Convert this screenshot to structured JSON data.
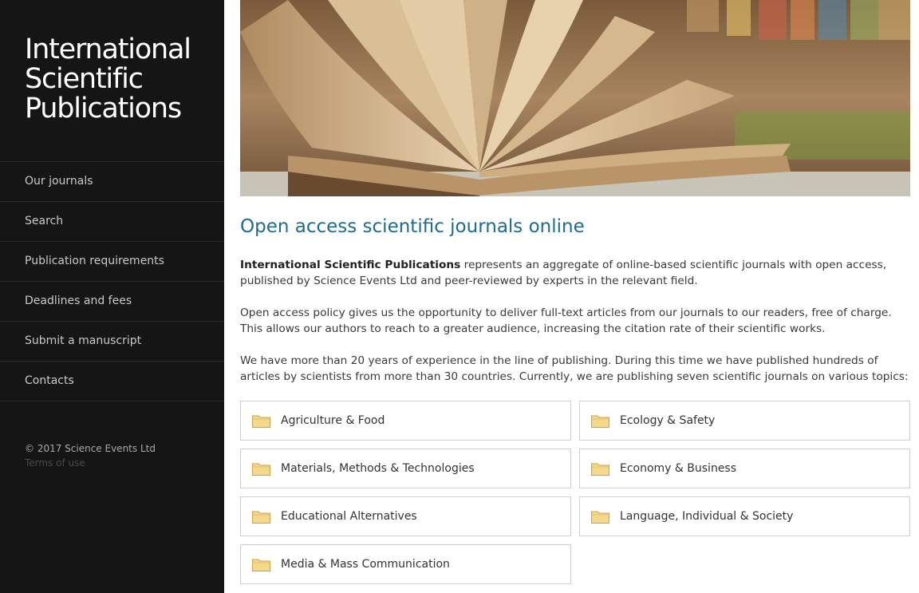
{
  "sidebar": {
    "brand": [
      "International",
      "Scientific",
      "Publications"
    ],
    "nav": [
      {
        "label": "Our journals",
        "name": "nav-our-journals"
      },
      {
        "label": "Search",
        "name": "nav-search"
      },
      {
        "label": "Publication requirements",
        "name": "nav-publication-requirements"
      },
      {
        "label": "Deadlines and fees",
        "name": "nav-deadlines-and-fees"
      },
      {
        "label": "Submit a manuscript",
        "name": "nav-submit-manuscript"
      },
      {
        "label": "Contacts",
        "name": "nav-contacts"
      }
    ],
    "copyright": "© 2017 Science Events Ltd",
    "terms": "Terms of use"
  },
  "main": {
    "heading": "Open access scientific journals online",
    "intro_strong": "International Scientific Publications",
    "intro_rest": " represents an aggregate of online-based scientific journals with open access, published by Science Events Ltd and peer-reviewed by experts in the relevant field.",
    "para2": "Open access policy gives us the opportunity to deliver full-text articles from our journals to our readers, free of charge. This allows our authors to reach to a greater audience, increasing the citation rate of their scientific works.",
    "para3": "We have more than 20 years of experience in the line of publishing. During this time we have published hundreds of articles by scientists from more than 30 countries. Currently, we are publishing seven scientific journals on various topics:",
    "journals": [
      "Agriculture & Food",
      "Ecology & Safety",
      "Materials, Methods & Technologies",
      "Economy & Business",
      "Educational Alternatives",
      "Language, Individual & Society",
      "Media & Mass Communication"
    ]
  },
  "icons": {
    "journal": "folder-icon"
  },
  "colors": {
    "sidebar_bg": "#151515",
    "heading": "#1d6b8f"
  }
}
